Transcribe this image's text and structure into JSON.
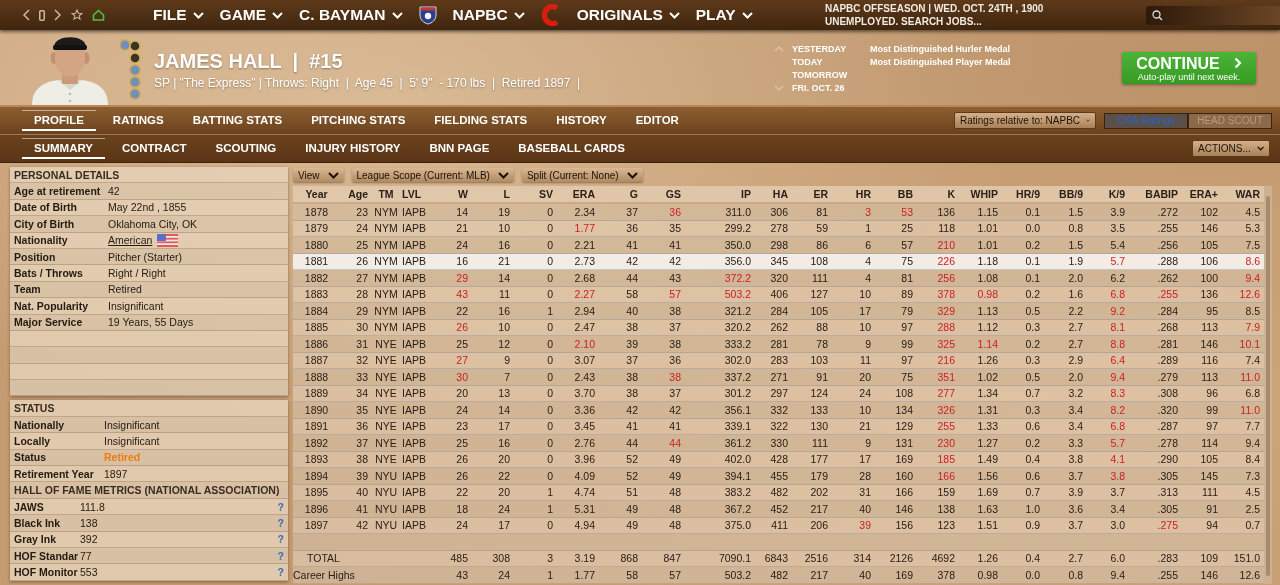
{
  "menus": [
    {
      "label": "FILE",
      "kind": "plain"
    },
    {
      "label": "GAME",
      "kind": "plain"
    },
    {
      "label": "C. BAYMAN",
      "kind": "plain"
    },
    {
      "label": "NAPBC",
      "kind": "league"
    },
    {
      "label": "ORIGINALS",
      "kind": "team"
    },
    {
      "label": "PLAY",
      "kind": "plain"
    }
  ],
  "game_status": {
    "season": "NAPBC OFFSEASON  |  WED. OCT. 24TH , 1900",
    "job": "UNEMPLOYED. SEARCH JOBS..."
  },
  "player": {
    "title": "JAMES HALL  |  #15",
    "subtitle": "SP | \"The Express\" | Throws: Right  |  Age 45  |  5' 9\"  - 170 lbs  |  Retired 1897  |"
  },
  "calendar": {
    "days": [
      {
        "label": "YESTERDAY",
        "event": "Most Distinguished Hurler Medal"
      },
      {
        "label": "TODAY",
        "event": "Most Distinguished Player Medal"
      },
      {
        "label": "TOMORROW"
      },
      {
        "label": "FRI. OCT. 26"
      }
    ]
  },
  "continue_button": {
    "label": "CONTINUE",
    "caption": "Auto-play until next week."
  },
  "tabs": [
    {
      "label": "PROFILE",
      "selected": true
    },
    {
      "label": "RATINGS",
      "selected": false
    },
    {
      "label": "BATTING STATS",
      "selected": false
    },
    {
      "label": "PITCHING STATS",
      "selected": false
    },
    {
      "label": "FIELDING STATS",
      "selected": false
    },
    {
      "label": "HISTORY",
      "selected": false
    },
    {
      "label": "EDITOR",
      "selected": false
    }
  ],
  "ratings_dropdown": "Ratings relative to: NAPBC",
  "rating_toggles": [
    {
      "label": "OSA Ratings",
      "selected": true,
      "disabled": false
    },
    {
      "label": "HEAD SCOUT",
      "selected": false,
      "disabled": true
    }
  ],
  "subtabs": [
    {
      "label": "SUMMARY",
      "selected": true
    },
    {
      "label": "CONTRACT",
      "selected": false
    },
    {
      "label": "SCOUTING",
      "selected": false
    },
    {
      "label": "INJURY HISTORY",
      "selected": false
    },
    {
      "label": "BNN PAGE",
      "selected": false
    },
    {
      "label": "BASEBALL CARDS",
      "selected": false
    }
  ],
  "actions_dropdown": "ACTIONS...",
  "personal_details": {
    "title": "PERSONAL DETAILS",
    "rows": [
      {
        "label": "Age at retirement",
        "value": "42",
        "kind": "text"
      },
      {
        "label": "Date of Birth",
        "value": "May 22nd , 1855",
        "kind": "text"
      },
      {
        "label": "City of Birth",
        "value": "Oklahoma City, OK",
        "kind": "text"
      },
      {
        "label": "Nationality",
        "value": "American",
        "kind": "nationality"
      },
      {
        "label": "Position",
        "value": "Pitcher (Starter)",
        "kind": "text"
      },
      {
        "label": "Bats / Throws",
        "value": "Right / Right",
        "kind": "text"
      },
      {
        "label": "Team",
        "value": "Retired",
        "kind": "text"
      },
      {
        "label": "Nat. Popularity",
        "value": "Insignificant",
        "kind": "text"
      },
      {
        "label": "Major Service",
        "value": "19 Years, 55 Days",
        "kind": "text"
      }
    ]
  },
  "status_section": {
    "title": "STATUS",
    "rows": [
      {
        "label": "Nationally",
        "value": "Insignificant",
        "highlight": false
      },
      {
        "label": "Locally",
        "value": "Insignificant",
        "highlight": false
      },
      {
        "label": "Status",
        "value": "Retired",
        "highlight": true
      },
      {
        "label": "Retirement Year",
        "value": "1897",
        "highlight": false
      }
    ]
  },
  "hof": {
    "title": "HALL OF FAME METRICS (NATIONAL ASSOCIATION)",
    "rows": [
      {
        "label": "JAWS",
        "value": "111.8",
        "help": "?"
      },
      {
        "label": "Black Ink",
        "value": "138",
        "help": "?"
      },
      {
        "label": "Gray Ink",
        "value": "392",
        "help": "?"
      },
      {
        "label": "HOF Standar",
        "value": "77",
        "help": "?"
      },
      {
        "label": "HOF Monitor",
        "value": "553",
        "help": "?"
      }
    ]
  },
  "filters": [
    "View",
    "League Scope (Current: MLB)",
    "Split (Current: None)"
  ],
  "stats": {
    "columns": [
      "Year",
      "Age",
      "TM",
      "LVL",
      "W",
      "L",
      "SV",
      "ERA",
      "G",
      "GS",
      "IP",
      "HA",
      "ER",
      "HR",
      "BB",
      "K",
      "WHIP",
      "HR/9",
      "BB/9",
      "K/9",
      "BABIP",
      "ERA+",
      "WAR"
    ],
    "rows": [
      {
        "selected": false,
        "cells": [
          "1878",
          "23",
          "NYM",
          "IAPB",
          "14",
          "19",
          "0",
          "2.34",
          "37",
          {
            "text": "36",
            "leader": true
          },
          "311.0",
          "306",
          "81",
          {
            "text": "3",
            "leader": true
          },
          {
            "text": "53",
            "leader": true
          },
          "136",
          "1.15",
          "0.1",
          "1.5",
          "3.9",
          ".272",
          "102",
          "4.5"
        ]
      },
      {
        "selected": false,
        "cells": [
          "1879",
          "24",
          "NYM",
          "IAPB",
          "21",
          "10",
          "0",
          {
            "text": "1.77",
            "leader": true
          },
          "36",
          "35",
          "299.2",
          "278",
          "59",
          "1",
          "25",
          "118",
          "1.01",
          "0.0",
          "0.8",
          "3.5",
          ".255",
          "146",
          "5.3"
        ]
      },
      {
        "selected": false,
        "cells": [
          "1880",
          "25",
          "NYM",
          "IAPB",
          "24",
          "16",
          "0",
          "2.21",
          "41",
          "41",
          "350.0",
          "298",
          "86",
          "6",
          "57",
          {
            "text": "210",
            "leader": true
          },
          "1.01",
          "0.2",
          "1.5",
          "5.4",
          ".256",
          "105",
          "7.5"
        ]
      },
      {
        "selected": true,
        "cells": [
          "1881",
          "26",
          "NYM",
          "IAPB",
          "16",
          "21",
          "0",
          "2.73",
          "42",
          "42",
          "356.0",
          "345",
          "108",
          "4",
          "75",
          {
            "text": "226",
            "leader": true
          },
          "1.18",
          "0.1",
          "1.9",
          {
            "text": "5.7",
            "leader": true
          },
          ".288",
          "106",
          {
            "text": "8.6",
            "leader": true
          }
        ]
      },
      {
        "selected": false,
        "cells": [
          "1882",
          "27",
          "NYM",
          "IAPB",
          {
            "text": "29",
            "leader": true
          },
          "14",
          "0",
          "2.68",
          "44",
          "43",
          {
            "text": "372.2",
            "leader": true
          },
          "320",
          "111",
          "4",
          "81",
          {
            "text": "256",
            "leader": true
          },
          "1.08",
          "0.1",
          "2.0",
          "6.2",
          ".262",
          "100",
          {
            "text": "9.4",
            "leader": true
          }
        ]
      },
      {
        "selected": false,
        "cells": [
          "1883",
          "28",
          "NYM",
          "IAPB",
          {
            "text": "43",
            "leader": true
          },
          "11",
          "0",
          {
            "text": "2.27",
            "leader": true
          },
          "58",
          {
            "text": "57",
            "leader": true
          },
          {
            "text": "503.2",
            "leader": true
          },
          "406",
          "127",
          "10",
          "89",
          {
            "text": "378",
            "leader": true
          },
          {
            "text": "0.98",
            "leader": true
          },
          "0.2",
          "1.6",
          {
            "text": "6.8",
            "leader": true
          },
          {
            "text": ".255",
            "leader": true
          },
          "136",
          {
            "text": "12.6",
            "leader": true
          }
        ]
      },
      {
        "selected": false,
        "cells": [
          "1884",
          "29",
          "NYM",
          "IAPB",
          "22",
          "16",
          "1",
          "2.94",
          "40",
          "38",
          "321.2",
          "284",
          "105",
          "17",
          "79",
          {
            "text": "329",
            "leader": true
          },
          "1.13",
          "0.5",
          "2.2",
          {
            "text": "9.2",
            "leader": true
          },
          ".284",
          "95",
          "8.5"
        ]
      },
      {
        "selected": false,
        "cells": [
          "1885",
          "30",
          "NYM",
          "IAPB",
          {
            "text": "26",
            "leader": true
          },
          "10",
          "0",
          "2.47",
          "38",
          "37",
          "320.2",
          "262",
          "88",
          "10",
          "97",
          {
            "text": "288",
            "leader": true
          },
          "1.12",
          "0.3",
          "2.7",
          {
            "text": "8.1",
            "leader": true
          },
          ".268",
          "113",
          {
            "text": "7.9",
            "leader": true
          }
        ]
      },
      {
        "selected": false,
        "cells": [
          "1886",
          "31",
          "NYE",
          "IAPB",
          "25",
          "12",
          "0",
          {
            "text": "2.10",
            "leader": true
          },
          "39",
          "38",
          "333.2",
          "281",
          "78",
          "9",
          "99",
          {
            "text": "325",
            "leader": true
          },
          {
            "text": "1.14",
            "leader": true
          },
          "0.2",
          "2.7",
          {
            "text": "8.8",
            "leader": true
          },
          ".281",
          "146",
          {
            "text": "10.1",
            "leader": true
          }
        ]
      },
      {
        "selected": false,
        "cells": [
          "1887",
          "32",
          "NYE",
          "IAPB",
          {
            "text": "27",
            "leader": true
          },
          "9",
          "0",
          "3.07",
          "37",
          "36",
          "302.0",
          "283",
          "103",
          "11",
          "97",
          {
            "text": "216",
            "leader": true
          },
          "1.26",
          "0.3",
          "2.9",
          {
            "text": "6.4",
            "leader": true
          },
          ".289",
          "116",
          "7.4"
        ]
      },
      {
        "selected": false,
        "cells": [
          "1888",
          "33",
          "NYE",
          "IAPB",
          {
            "text": "30",
            "leader": true
          },
          "7",
          "0",
          "2.43",
          "38",
          {
            "text": "38",
            "leader": true
          },
          "337.2",
          "271",
          "91",
          "20",
          "75",
          {
            "text": "351",
            "leader": true
          },
          "1.02",
          "0.5",
          "2.0",
          {
            "text": "9.4",
            "leader": true
          },
          ".279",
          "113",
          {
            "text": "11.0",
            "leader": true
          }
        ]
      },
      {
        "selected": false,
        "cells": [
          "1889",
          "34",
          "NYE",
          "IAPB",
          "20",
          "13",
          "0",
          "3.70",
          "38",
          "37",
          "301.2",
          "297",
          "124",
          "24",
          "108",
          {
            "text": "277",
            "leader": true
          },
          "1.34",
          "0.7",
          "3.2",
          {
            "text": "8.3",
            "leader": true
          },
          ".308",
          "96",
          "6.8"
        ]
      },
      {
        "selected": false,
        "cells": [
          "1890",
          "35",
          "NYE",
          "IAPB",
          "24",
          "14",
          "0",
          "3.36",
          "42",
          "42",
          "356.1",
          "332",
          "133",
          "10",
          "134",
          {
            "text": "326",
            "leader": true
          },
          "1.31",
          "0.3",
          "3.4",
          {
            "text": "8.2",
            "leader": true
          },
          ".320",
          "99",
          {
            "text": "11.0",
            "leader": true
          }
        ]
      },
      {
        "selected": false,
        "cells": [
          "1891",
          "36",
          "NYE",
          "IAPB",
          "23",
          "17",
          "0",
          "3.45",
          "41",
          "41",
          "339.1",
          "322",
          "130",
          "21",
          "129",
          {
            "text": "255",
            "leader": true
          },
          "1.33",
          "0.6",
          "3.4",
          {
            "text": "6.8",
            "leader": true
          },
          ".287",
          "97",
          "7.7"
        ]
      },
      {
        "selected": false,
        "cells": [
          "1892",
          "37",
          "NYE",
          "IAPB",
          "25",
          "16",
          "0",
          "2.76",
          "44",
          {
            "text": "44",
            "leader": true
          },
          "361.2",
          "330",
          "111",
          "9",
          "131",
          {
            "text": "230",
            "leader": true
          },
          "1.27",
          "0.2",
          "3.3",
          {
            "text": "5.7",
            "leader": true
          },
          ".278",
          "114",
          "9.4"
        ]
      },
      {
        "selected": false,
        "cells": [
          "1893",
          "38",
          "NYE",
          "IAPB",
          "26",
          "20",
          "0",
          "3.96",
          "52",
          "49",
          "402.0",
          "428",
          "177",
          "17",
          "169",
          {
            "text": "185",
            "leader": true
          },
          "1.49",
          "0.4",
          "3.8",
          {
            "text": "4.1",
            "leader": true
          },
          ".290",
          "105",
          "8.4"
        ]
      },
      {
        "selected": false,
        "cells": [
          "1894",
          "39",
          "NYU",
          "IAPB",
          "26",
          "22",
          "0",
          "4.09",
          "52",
          "49",
          "394.1",
          "455",
          "179",
          "28",
          "160",
          {
            "text": "166",
            "leader": true
          },
          "1.56",
          "0.6",
          "3.7",
          {
            "text": "3.8",
            "leader": true
          },
          ".305",
          "145",
          "7.3"
        ]
      },
      {
        "selected": false,
        "cells": [
          "1895",
          "40",
          "NYU",
          "IAPB",
          "22",
          "20",
          "1",
          "4.74",
          "51",
          "48",
          "383.2",
          "482",
          "202",
          "31",
          "166",
          "159",
          "1.69",
          "0.7",
          "3.9",
          "3.7",
          ".313",
          "111",
          "4.5"
        ]
      },
      {
        "selected": false,
        "cells": [
          "1896",
          "41",
          "NYU",
          "IAPB",
          "18",
          "24",
          "1",
          "5.31",
          "49",
          "48",
          "367.2",
          "452",
          "217",
          "40",
          "146",
          "138",
          "1.63",
          "1.0",
          "3.6",
          "3.4",
          ".305",
          "91",
          "2.5"
        ]
      },
      {
        "selected": false,
        "cells": [
          "1897",
          "42",
          "NYU",
          "IAPB",
          "24",
          "17",
          "0",
          "4.94",
          "49",
          "48",
          "375.0",
          "411",
          "206",
          {
            "text": "39",
            "leader": true
          },
          "156",
          "123",
          "1.51",
          "0.9",
          "3.7",
          "3.0",
          {
            "text": ".275",
            "leader": true
          },
          "94",
          "0.7"
        ]
      }
    ],
    "summary": [
      {
        "label": "TOTAL",
        "kind": "total",
        "cells": [
          "485",
          "308",
          "3",
          "3.19",
          "868",
          "847",
          "7090.1",
          "6843",
          "2516",
          "314",
          "2126",
          "4692",
          "1.26",
          "0.4",
          "2.7",
          "6.0",
          ".283",
          "109",
          "151.0"
        ]
      },
      {
        "label": "Career Highs",
        "kind": "highs",
        "cells": [
          "43",
          "24",
          "1",
          "1.77",
          "58",
          "57",
          "503.2",
          "482",
          "217",
          "40",
          "169",
          "378",
          "0.98",
          "0.0",
          "0.8",
          "9.4",
          ".255",
          "146",
          "12.6"
        ]
      }
    ]
  }
}
